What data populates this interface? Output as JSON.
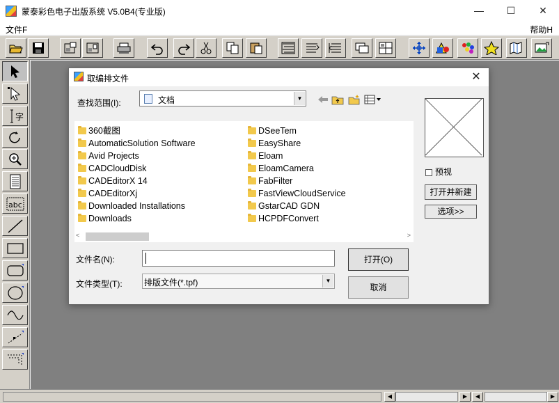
{
  "window": {
    "title": "蒙泰彩色电子出版系统 V5.0B4(专业版)",
    "minimize": "—",
    "maximize": "☐",
    "close": "✕"
  },
  "menu": {
    "file": "文件F",
    "help": "帮助H"
  },
  "toolbar": {
    "buttons": [
      "open-folder-icon",
      "save-icon",
      "frame-icon",
      "columns-icon",
      "printer-icon",
      "undo-icon",
      "redo-icon",
      "scissors-icon",
      "copy-icon",
      "paste-icon",
      "text-left-icon",
      "text-right-icon",
      "text-flow-icon",
      "pages-icon",
      "grid-icon",
      "move-icon",
      "shapes-color-icon",
      "color-palette-icon",
      "star-icon",
      "map-icon",
      "picture-icon"
    ]
  },
  "tools": [
    "pointer",
    "subselect",
    "text",
    "rotate",
    "zoom",
    "page",
    "abc",
    "line",
    "rectangle",
    "rounded-rectangle",
    "ellipse",
    "curve",
    "dotted-line",
    "dotted-rect"
  ],
  "tool_labels": {
    "text": "字",
    "abc": "abc"
  },
  "dialog": {
    "title": "取编排文件",
    "close": "✕",
    "look_in_label": "查找范围(I):",
    "look_in_value": "文档",
    "files_col1": [
      "360截图",
      "AutomaticSolution Software",
      "Avid Projects",
      "CADCloudDisk",
      "CADEditorX 14",
      "CADEditorXj",
      "Downloaded Installations",
      "Downloads"
    ],
    "files_col2": [
      "DSeeTem",
      "EasyShare",
      "Eloam",
      "EloamCamera",
      "FabFilter",
      "FastViewCloudService",
      "GstarCAD GDN",
      "HCPDFConvert"
    ],
    "filename_label": "文件名(N):",
    "filename_value": "",
    "filetype_label": "文件类型(T):",
    "filetype_value": "排版文件(*.tpf)",
    "open_button": "打开(O)",
    "cancel_button": "取消",
    "preview_label": "预视",
    "open_new_button": "打开并新建",
    "options_button": "选项>>"
  }
}
